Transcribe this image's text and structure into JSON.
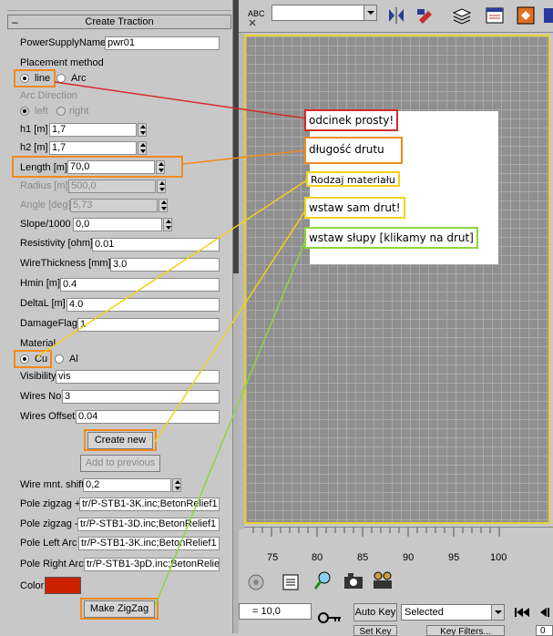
{
  "rollout": {
    "collapse": "–",
    "title": "Create Traction"
  },
  "params": {
    "power_supply_name": {
      "label": "PowerSupplyName",
      "value": "pwr01"
    },
    "placement_method": {
      "label": "Placement method",
      "opt_line": "line",
      "opt_arc": "Arc",
      "selected": "line"
    },
    "arc_direction": {
      "label": "Arc Direction",
      "opt_left": "left",
      "opt_right": "right"
    },
    "h1": {
      "label": "h1 [m]",
      "value": "1,7"
    },
    "h2": {
      "label": "h2 [m]",
      "value": "1,7"
    },
    "length": {
      "label": "Length [m]",
      "value": "70,0"
    },
    "radius": {
      "label": "Radius [m]",
      "value": "500,0"
    },
    "angle": {
      "label": "Angle [deg]",
      "value": "5,73"
    },
    "slope": {
      "label": "Slope/1000",
      "value": "0,0"
    },
    "resistivity": {
      "label": "Resistivity [ohm]",
      "value": "0.01"
    },
    "wire_thickness": {
      "label": "WireThickness [mm]",
      "value": "3.0"
    },
    "hmin": {
      "label": "Hmin [m]",
      "value": "0.4"
    },
    "deltal": {
      "label": "DeltaL [m]",
      "value": "4.0"
    },
    "damage_flag": {
      "label": "DamageFlag",
      "value": "1"
    },
    "material": {
      "label": "Material",
      "opt_cu": "Cu",
      "opt_al": "Al",
      "selected": "Cu"
    },
    "visibility": {
      "label": "Visibility",
      "value": "vis"
    },
    "wires_no": {
      "label": "Wires No",
      "value": "3"
    },
    "wires_offset": {
      "label": "Wires Offset",
      "value": "0.04"
    },
    "create_new": "Create new",
    "add_to_previous": "Add to previous",
    "wire_mnt_shift": {
      "label": "Wire mnt. shift",
      "value": "0,2"
    },
    "pole_zigzag_plus": {
      "label": "Pole zigzag +",
      "value": "tr/P-STB1-3K.inc;BetonRelief1"
    },
    "pole_zigzag_minus": {
      "label": "Pole zigzag -",
      "value": "tr/P-STB1-3D.inc;BetonRelief1"
    },
    "pole_left_arc": {
      "label": "Pole Left Arc",
      "value": "tr/P-STB1-3K.inc;BetonRelief1"
    },
    "pole_right_arc": {
      "label": "Pole Right Arc",
      "value": "tr/P-STB1-3pD.inc;BetonRelie"
    },
    "color": {
      "label": "Color",
      "value": "#cc2200"
    },
    "make_zigzag": "Make ZigZag"
  },
  "annotations": {
    "note1": "odcinek prosty!",
    "note2": "długość drutu",
    "note3": "Rodzaj materiału",
    "note4": "wstaw sam drut!",
    "note5": "wstaw słupy [klikamy na drut]"
  },
  "colors": {
    "red": "#d42a2a",
    "orange": "#f08a1e",
    "yellow": "#f2d01a",
    "green": "#8ad83a"
  },
  "timeline": {
    "ticks": [
      "75",
      "80",
      "85",
      "90",
      "95",
      "100"
    ]
  },
  "bottom": {
    "frame_value": "= 10,0",
    "auto_key": "Auto Key",
    "selected": "Selected",
    "set_key": "Set Key",
    "key_filters": "Key Filters...",
    "frame_field": "0"
  },
  "toolbar": {
    "combo_value": ""
  }
}
